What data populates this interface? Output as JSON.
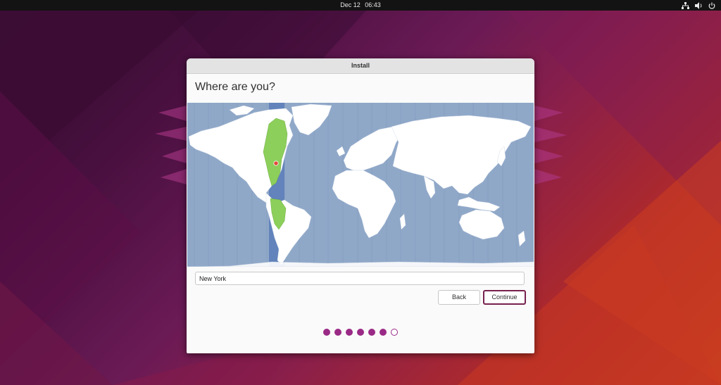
{
  "topbar": {
    "date": "Dec 12",
    "time": "06:43",
    "icons": [
      "network-icon",
      "volume-icon",
      "power-icon"
    ]
  },
  "window": {
    "title": "Install",
    "heading": "Where are you?",
    "location_value": "New York",
    "back_label": "Back",
    "continue_label": "Continue",
    "progress": {
      "total_steps": 7,
      "completed_steps": 6
    }
  },
  "colors": {
    "ocean": "#90a8c8",
    "land": "#ffffff",
    "selected_zone_band": "#5b7db8",
    "selected_zone_land": "#8ccf5a",
    "accent": "#77214f",
    "dot": "#9a2a86",
    "marker": "#e04a3a"
  }
}
